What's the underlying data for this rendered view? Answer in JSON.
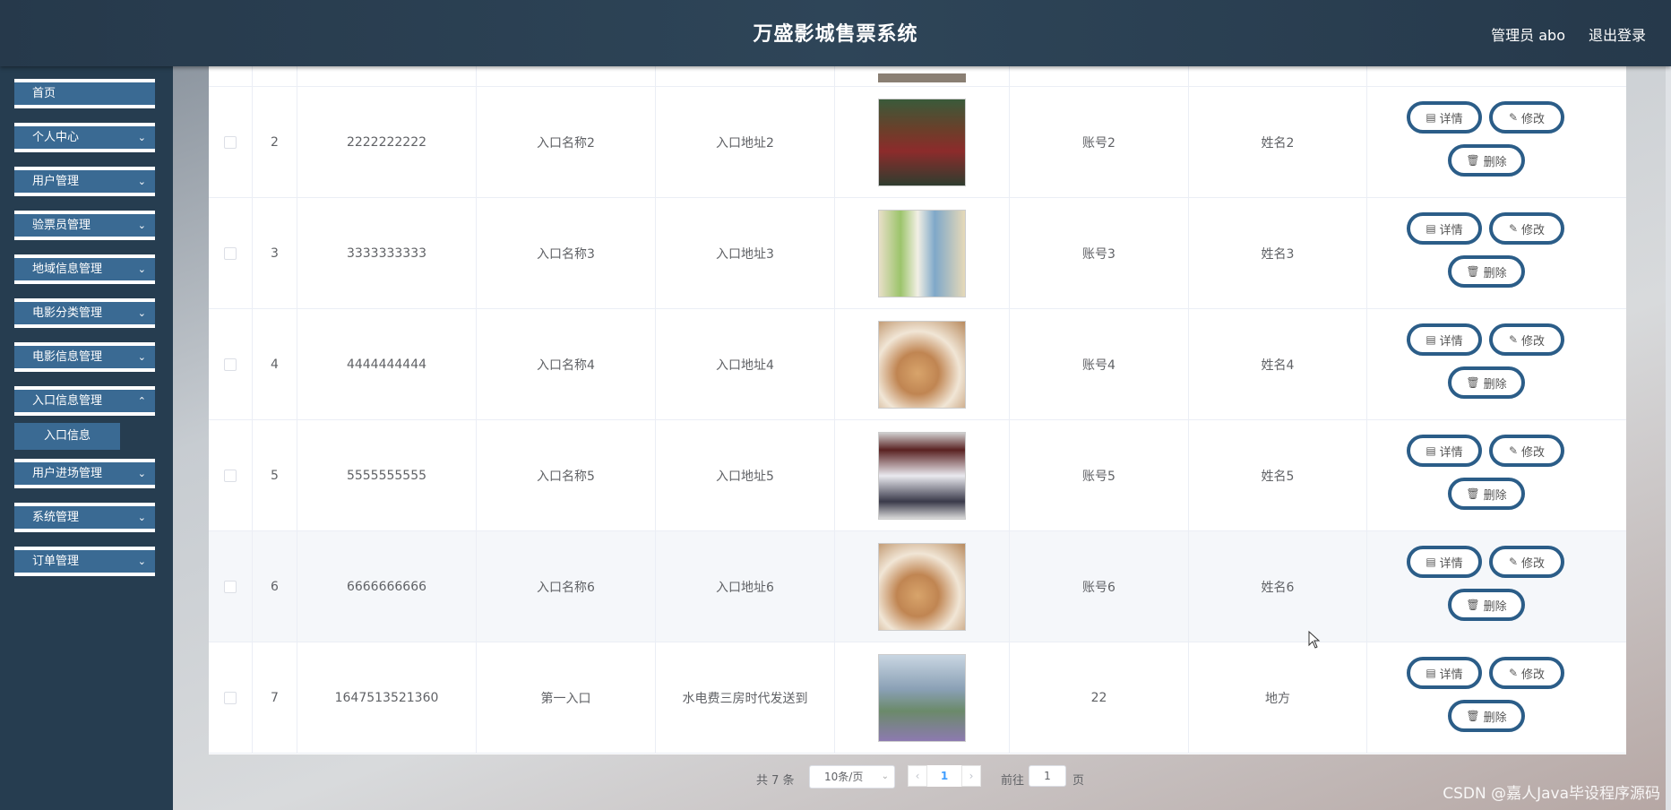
{
  "header": {
    "title": "万盛影城售票系统",
    "admin": "管理员 abo",
    "logout": "退出登录"
  },
  "sidebar": {
    "items": [
      {
        "label": "首页",
        "chev": ""
      },
      {
        "label": "个人中心",
        "chev": "⌄"
      },
      {
        "label": "用户管理",
        "chev": "⌄"
      },
      {
        "label": "验票员管理",
        "chev": "⌄"
      },
      {
        "label": "地域信息管理",
        "chev": "⌄"
      },
      {
        "label": "电影分类管理",
        "chev": "⌄"
      },
      {
        "label": "电影信息管理",
        "chev": "⌄"
      },
      {
        "label": "入口信息管理",
        "chev": "⌃"
      },
      {
        "label": "用户进场管理",
        "chev": "⌄"
      },
      {
        "label": "系统管理",
        "chev": "⌄"
      },
      {
        "label": "订单管理",
        "chev": "⌄"
      }
    ],
    "submenu": "入口信息"
  },
  "table": {
    "rows": [
      {
        "index": "2",
        "code": "2222222222",
        "name": "入口名称2",
        "address": "入口地址2",
        "account": "账号2",
        "person": "姓名2",
        "img": "store-front"
      },
      {
        "index": "3",
        "code": "3333333333",
        "name": "入口名称3",
        "address": "入口地址3",
        "account": "账号3",
        "person": "姓名3",
        "img": "shop-shelves"
      },
      {
        "index": "4",
        "code": "4444444444",
        "name": "入口名称4",
        "address": "入口地址4",
        "account": "账号4",
        "person": "姓名4",
        "img": "bakery-interior"
      },
      {
        "index": "5",
        "code": "5555555555",
        "name": "入口名称5",
        "address": "入口地址5",
        "account": "账号5",
        "person": "姓名5",
        "img": "boutique-entrance"
      },
      {
        "index": "6",
        "code": "6666666666",
        "name": "入口名称6",
        "address": "入口地址6",
        "account": "账号6",
        "person": "姓名6",
        "img": "bakery-interior"
      },
      {
        "index": "7",
        "code": "1647513521360",
        "name": "第一入口",
        "address": "水电费三房时代发送到",
        "account": "22",
        "person": "地方",
        "img": "plaza"
      }
    ],
    "actions": {
      "detail": "详情",
      "edit": "修改",
      "delete": "删除"
    }
  },
  "pagination": {
    "total": "共 7 条",
    "page_size": "10条/页",
    "current_page": "1",
    "goto_label": "前往",
    "goto_value": "1",
    "page_unit": "页"
  },
  "watermark": "CSDN @嘉人Java毕设程序源码",
  "colors": {
    "accent": "#2b5d88",
    "menu": "#3a6a93",
    "header": "#26394b",
    "link": "#409eff"
  }
}
